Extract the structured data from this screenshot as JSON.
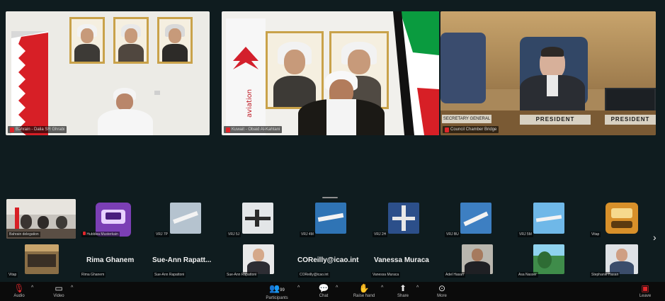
{
  "main_tiles": [
    {
      "label": "Bahrain - Dalia SR Ghrabi"
    },
    {
      "label": "Kuwait - Obaid Al-Kahtani"
    },
    {
      "label": "Council Chamber Bridge"
    }
  ],
  "nameplates": {
    "left": "SECRETARY GENERAL",
    "center": "PRESIDENT",
    "right": "PRESIDENT"
  },
  "gallery_row1": [
    {
      "label": "Bahrain delegation"
    },
    {
      "label": "Hubblea Musterkain"
    },
    {
      "label": "VRJ 7P"
    },
    {
      "label": "VRJ 5J"
    },
    {
      "label": "VRJ 4M"
    },
    {
      "label": "VRJ 2H"
    },
    {
      "label": "VRJ BU"
    },
    {
      "label": "VRJ 5M"
    },
    {
      "label": "Vitap"
    }
  ],
  "gallery_row2": [
    {
      "label": "Vitap",
      "display": ""
    },
    {
      "label": "Rima Ghanem",
      "display": "Rima Ghanem"
    },
    {
      "label": "Sue-Ann Rapattoni",
      "display": "Sue-Ann Rapatt..."
    },
    {
      "label": "Sue-Ann Rapattoni",
      "display": ""
    },
    {
      "label": "COReilly@icao.int",
      "display": "COReilly@icao.int"
    },
    {
      "label": "Vanessa Muraca",
      "display": "Vanessa Muraca"
    },
    {
      "label": "Adel Hasan",
      "display": ""
    },
    {
      "label": "Asa Nasser",
      "display": ""
    },
    {
      "label": "Stephanie Hasan",
      "display": ""
    }
  ],
  "toolbar": {
    "audio": "Audio",
    "video": "Video",
    "participants": "Participants",
    "participants_count": "99",
    "chat": "Chat",
    "raise_hand": "Raise hand",
    "share": "Share",
    "more": "More",
    "leave": "Leave"
  },
  "colors": {
    "background": "#0f1c1f",
    "mic_off": "#e0262b",
    "toolbar": "#0b0b0b"
  }
}
